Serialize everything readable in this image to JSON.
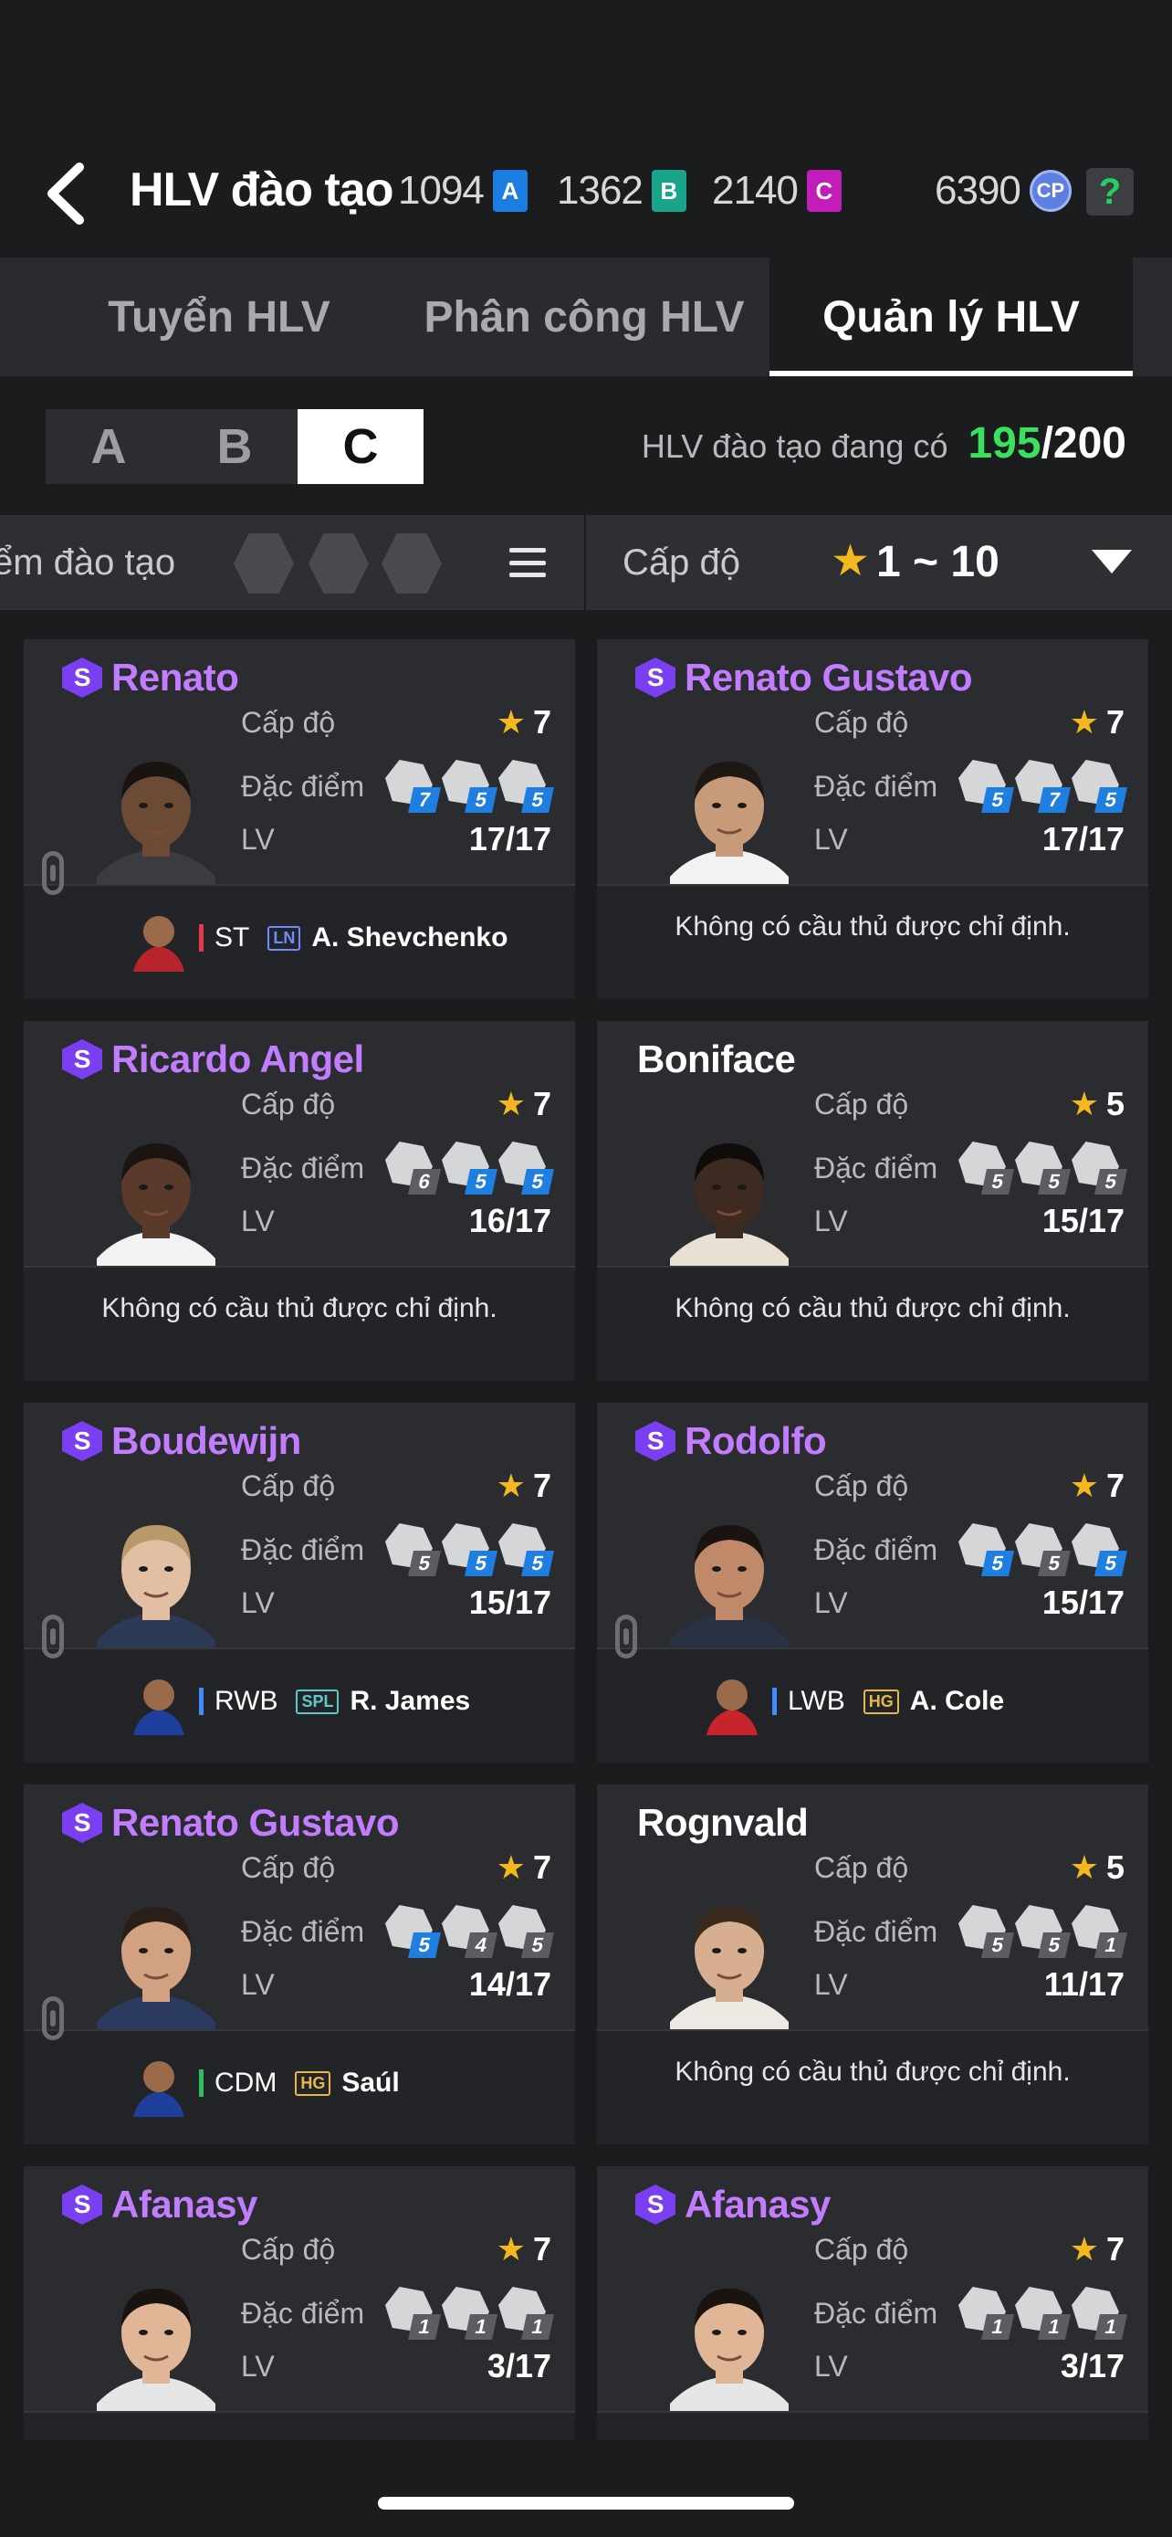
{
  "header": {
    "title": "HLV đào tạo",
    "currencies": [
      {
        "value": "1094",
        "icon": "A"
      },
      {
        "value": "1362",
        "icon": "B"
      },
      {
        "value": "2140",
        "icon": "C"
      }
    ],
    "cp": {
      "value": "6390",
      "icon": "CP"
    },
    "help": "?"
  },
  "tabs": [
    "Tuyển HLV",
    "Phân công HLV",
    "Quản lý HLV"
  ],
  "groups": [
    "A",
    "B",
    "C"
  ],
  "active_group": "C",
  "capacity": {
    "label": "HLV đào tạo đang có",
    "current": "195",
    "total": "/200"
  },
  "filter": {
    "left_label": "ểm đào tạo",
    "right_label": "Cấp độ",
    "range": "1 ~ 10"
  },
  "labels": {
    "level": "Cấp độ",
    "traits": "Đặc điểm",
    "traits_cut": "Đặc điểm",
    "lv": "LV"
  },
  "cards": [
    {
      "name": "Renato",
      "rare": true,
      "level": "7",
      "traits": [
        "7",
        "5",
        "5"
      ],
      "lv": "17/17",
      "assigned": {
        "pos": "ST",
        "pos_color": "#e8364b",
        "tag": "LN",
        "tag_color": "#6f8cff",
        "player": "A. Shevchenko"
      }
    },
    {
      "name": "Renato Gustavo",
      "rare": true,
      "level": "7",
      "traits": [
        "5",
        "7",
        "5"
      ],
      "lv": "17/17",
      "empty": "Không có cầu thủ được chỉ định."
    },
    {
      "name": "Ricardo Angel",
      "rare": true,
      "level": "7",
      "traits": [
        "6",
        "5",
        "5"
      ],
      "lv": "16/17",
      "empty": "Không có cầu thủ được chỉ định."
    },
    {
      "name": "Boniface",
      "rare": false,
      "level": "5",
      "traits": [
        "5",
        "5",
        "5"
      ],
      "lv": "15/17",
      "empty": "Không có cầu thủ được chỉ định."
    },
    {
      "name": "Boudewijn",
      "rare": true,
      "level": "7",
      "traits": [
        "5",
        "5",
        "5"
      ],
      "lv": "15/17",
      "assigned": {
        "pos": "RWB",
        "pos_color": "#3e8cff",
        "tag": "SPL",
        "tag_color": "#5fc9c9",
        "player": "R. James"
      }
    },
    {
      "name": "Rodolfo",
      "rare": true,
      "level": "7",
      "traits": [
        "5",
        "5",
        "5"
      ],
      "lv": "15/17",
      "assigned": {
        "pos": "LWB",
        "pos_color": "#3e8cff",
        "tag": "HG",
        "tag_color": "#e6b84a",
        "player": "A. Cole"
      }
    },
    {
      "name": "Renato Gustavo",
      "rare": true,
      "level": "7",
      "traits": [
        "5",
        "4",
        "5"
      ],
      "lv": "14/17",
      "assigned": {
        "pos": "CDM",
        "pos_color": "#2fbf5c",
        "tag": "HG",
        "tag_color": "#e6b84a",
        "player": "Saúl"
      }
    },
    {
      "name": "Rognvald",
      "rare": false,
      "level": "5",
      "traits": [
        "5",
        "5",
        "1"
      ],
      "lv": "11/17",
      "empty": "Không có cầu thủ được chỉ định."
    },
    {
      "name": "Afanasy",
      "rare": true,
      "level": "7",
      "traits": [
        "1",
        "1",
        "1"
      ],
      "lv": "3/17"
    },
    {
      "name": "Afanasy",
      "rare": true,
      "level": "7",
      "traits": [
        "1",
        "1",
        "1"
      ],
      "lv": "3/17"
    }
  ]
}
